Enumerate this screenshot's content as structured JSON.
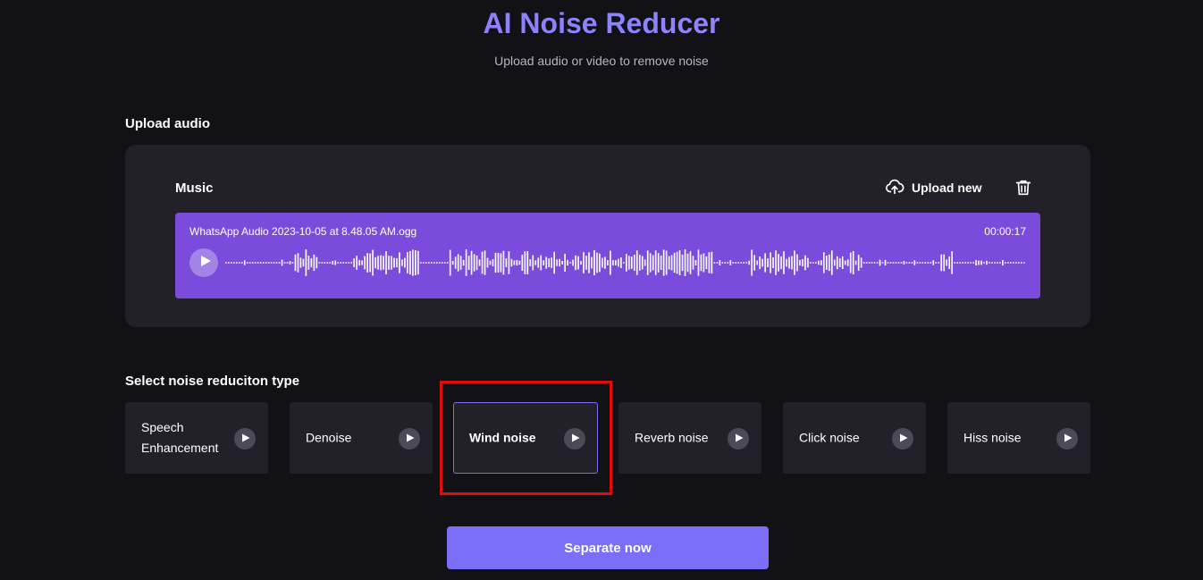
{
  "header": {
    "title": "AI Noise Reducer",
    "subtitle": "Upload audio or video to remove noise"
  },
  "upload": {
    "section_label": "Upload audio",
    "card_title": "Music",
    "upload_new_label": "Upload new",
    "upload_icon": "cloud-upload-icon",
    "delete_icon": "trash-icon",
    "player": {
      "file_name": "WhatsApp Audio 2023-10-05 at 8.48.05 AM.ogg",
      "duration": "00:00:17",
      "play_icon": "play-icon"
    }
  },
  "noise_types": {
    "section_label": "Select noise reduciton type",
    "options": [
      {
        "label": "Speech Enhancement",
        "selected": false
      },
      {
        "label": "Denoise",
        "selected": false
      },
      {
        "label": "Wind noise",
        "selected": true
      },
      {
        "label": "Reverb noise",
        "selected": false
      },
      {
        "label": "Click noise",
        "selected": false
      },
      {
        "label": "Hiss noise",
        "selected": false
      }
    ]
  },
  "cta": {
    "label": "Separate now"
  },
  "colors": {
    "background": "#121116",
    "card": "#22212a",
    "player": "#7b4cdb",
    "accent": "#7b6ef8",
    "highlight": "#e00d0d"
  }
}
